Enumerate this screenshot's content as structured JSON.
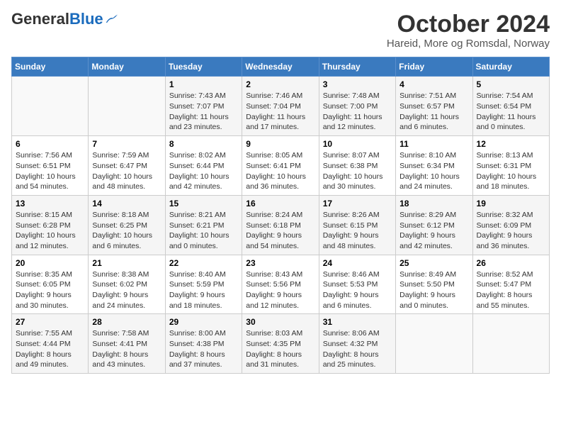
{
  "header": {
    "logo_general": "General",
    "logo_blue": "Blue",
    "month": "October 2024",
    "location": "Hareid, More og Romsdal, Norway"
  },
  "days_of_week": [
    "Sunday",
    "Monday",
    "Tuesday",
    "Wednesday",
    "Thursday",
    "Friday",
    "Saturday"
  ],
  "weeks": [
    [
      {
        "day": "",
        "detail": ""
      },
      {
        "day": "",
        "detail": ""
      },
      {
        "day": "1",
        "detail": "Sunrise: 7:43 AM\nSunset: 7:07 PM\nDaylight: 11 hours\nand 23 minutes."
      },
      {
        "day": "2",
        "detail": "Sunrise: 7:46 AM\nSunset: 7:04 PM\nDaylight: 11 hours\nand 17 minutes."
      },
      {
        "day": "3",
        "detail": "Sunrise: 7:48 AM\nSunset: 7:00 PM\nDaylight: 11 hours\nand 12 minutes."
      },
      {
        "day": "4",
        "detail": "Sunrise: 7:51 AM\nSunset: 6:57 PM\nDaylight: 11 hours\nand 6 minutes."
      },
      {
        "day": "5",
        "detail": "Sunrise: 7:54 AM\nSunset: 6:54 PM\nDaylight: 11 hours\nand 0 minutes."
      }
    ],
    [
      {
        "day": "6",
        "detail": "Sunrise: 7:56 AM\nSunset: 6:51 PM\nDaylight: 10 hours\nand 54 minutes."
      },
      {
        "day": "7",
        "detail": "Sunrise: 7:59 AM\nSunset: 6:47 PM\nDaylight: 10 hours\nand 48 minutes."
      },
      {
        "day": "8",
        "detail": "Sunrise: 8:02 AM\nSunset: 6:44 PM\nDaylight: 10 hours\nand 42 minutes."
      },
      {
        "day": "9",
        "detail": "Sunrise: 8:05 AM\nSunset: 6:41 PM\nDaylight: 10 hours\nand 36 minutes."
      },
      {
        "day": "10",
        "detail": "Sunrise: 8:07 AM\nSunset: 6:38 PM\nDaylight: 10 hours\nand 30 minutes."
      },
      {
        "day": "11",
        "detail": "Sunrise: 8:10 AM\nSunset: 6:34 PM\nDaylight: 10 hours\nand 24 minutes."
      },
      {
        "day": "12",
        "detail": "Sunrise: 8:13 AM\nSunset: 6:31 PM\nDaylight: 10 hours\nand 18 minutes."
      }
    ],
    [
      {
        "day": "13",
        "detail": "Sunrise: 8:15 AM\nSunset: 6:28 PM\nDaylight: 10 hours\nand 12 minutes."
      },
      {
        "day": "14",
        "detail": "Sunrise: 8:18 AM\nSunset: 6:25 PM\nDaylight: 10 hours\nand 6 minutes."
      },
      {
        "day": "15",
        "detail": "Sunrise: 8:21 AM\nSunset: 6:21 PM\nDaylight: 10 hours\nand 0 minutes."
      },
      {
        "day": "16",
        "detail": "Sunrise: 8:24 AM\nSunset: 6:18 PM\nDaylight: 9 hours\nand 54 minutes."
      },
      {
        "day": "17",
        "detail": "Sunrise: 8:26 AM\nSunset: 6:15 PM\nDaylight: 9 hours\nand 48 minutes."
      },
      {
        "day": "18",
        "detail": "Sunrise: 8:29 AM\nSunset: 6:12 PM\nDaylight: 9 hours\nand 42 minutes."
      },
      {
        "day": "19",
        "detail": "Sunrise: 8:32 AM\nSunset: 6:09 PM\nDaylight: 9 hours\nand 36 minutes."
      }
    ],
    [
      {
        "day": "20",
        "detail": "Sunrise: 8:35 AM\nSunset: 6:05 PM\nDaylight: 9 hours\nand 30 minutes."
      },
      {
        "day": "21",
        "detail": "Sunrise: 8:38 AM\nSunset: 6:02 PM\nDaylight: 9 hours\nand 24 minutes."
      },
      {
        "day": "22",
        "detail": "Sunrise: 8:40 AM\nSunset: 5:59 PM\nDaylight: 9 hours\nand 18 minutes."
      },
      {
        "day": "23",
        "detail": "Sunrise: 8:43 AM\nSunset: 5:56 PM\nDaylight: 9 hours\nand 12 minutes."
      },
      {
        "day": "24",
        "detail": "Sunrise: 8:46 AM\nSunset: 5:53 PM\nDaylight: 9 hours\nand 6 minutes."
      },
      {
        "day": "25",
        "detail": "Sunrise: 8:49 AM\nSunset: 5:50 PM\nDaylight: 9 hours\nand 0 minutes."
      },
      {
        "day": "26",
        "detail": "Sunrise: 8:52 AM\nSunset: 5:47 PM\nDaylight: 8 hours\nand 55 minutes."
      }
    ],
    [
      {
        "day": "27",
        "detail": "Sunrise: 7:55 AM\nSunset: 4:44 PM\nDaylight: 8 hours\nand 49 minutes."
      },
      {
        "day": "28",
        "detail": "Sunrise: 7:58 AM\nSunset: 4:41 PM\nDaylight: 8 hours\nand 43 minutes."
      },
      {
        "day": "29",
        "detail": "Sunrise: 8:00 AM\nSunset: 4:38 PM\nDaylight: 8 hours\nand 37 minutes."
      },
      {
        "day": "30",
        "detail": "Sunrise: 8:03 AM\nSunset: 4:35 PM\nDaylight: 8 hours\nand 31 minutes."
      },
      {
        "day": "31",
        "detail": "Sunrise: 8:06 AM\nSunset: 4:32 PM\nDaylight: 8 hours\nand 25 minutes."
      },
      {
        "day": "",
        "detail": ""
      },
      {
        "day": "",
        "detail": ""
      }
    ]
  ]
}
